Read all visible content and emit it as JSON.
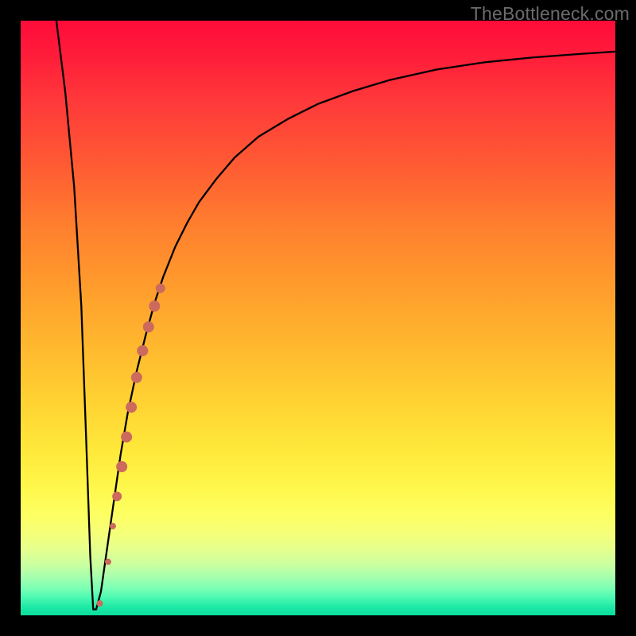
{
  "watermark": "TheBottleneck.com",
  "colors": {
    "frame": "#000000",
    "curve_stroke": "#000000",
    "marker_fill": "#cc6a5d",
    "marker_stroke": "#a84e45"
  },
  "chart_data": {
    "type": "line",
    "title": "",
    "xlabel": "",
    "ylabel": "",
    "xlim": [
      0,
      100
    ],
    "ylim": [
      0,
      100
    ],
    "series": [
      {
        "name": "bottleneck-curve",
        "x": [
          6.0,
          7.5,
          9.0,
          10.2,
          11.0,
          11.7,
          12.2,
          12.7,
          13.5,
          14.5,
          15.5,
          16.8,
          18.0,
          19.5,
          21.0,
          22.5,
          24.0,
          26.0,
          28.0,
          30.0,
          33.0,
          36.0,
          40.0,
          45.0,
          50.0,
          56.0,
          62.0,
          70.0,
          78.0,
          86.0,
          94.0,
          100.0
        ],
        "y": [
          100.0,
          88.0,
          72.0,
          52.0,
          30.0,
          10.0,
          1.0,
          1.0,
          4.0,
          11.0,
          18.0,
          27.0,
          34.0,
          41.0,
          47.0,
          52.5,
          57.0,
          62.0,
          66.0,
          69.5,
          73.5,
          77.0,
          80.5,
          83.5,
          86.0,
          88.2,
          90.0,
          91.8,
          93.0,
          93.8,
          94.4,
          94.8
        ]
      }
    ],
    "markers": {
      "name": "highlighted-segment",
      "points": [
        {
          "x": 13.3,
          "y": 2.0,
          "r": 4
        },
        {
          "x": 14.7,
          "y": 9.0,
          "r": 4
        },
        {
          "x": 15.5,
          "y": 15.0,
          "r": 4
        },
        {
          "x": 16.2,
          "y": 20.0,
          "r": 6
        },
        {
          "x": 17.0,
          "y": 25.0,
          "r": 7
        },
        {
          "x": 17.8,
          "y": 30.0,
          "r": 7
        },
        {
          "x": 18.6,
          "y": 35.0,
          "r": 7
        },
        {
          "x": 19.5,
          "y": 40.0,
          "r": 7
        },
        {
          "x": 20.5,
          "y": 44.5,
          "r": 7
        },
        {
          "x": 21.5,
          "y": 48.5,
          "r": 7
        },
        {
          "x": 22.5,
          "y": 52.0,
          "r": 7
        },
        {
          "x": 23.5,
          "y": 55.0,
          "r": 6
        }
      ]
    }
  }
}
